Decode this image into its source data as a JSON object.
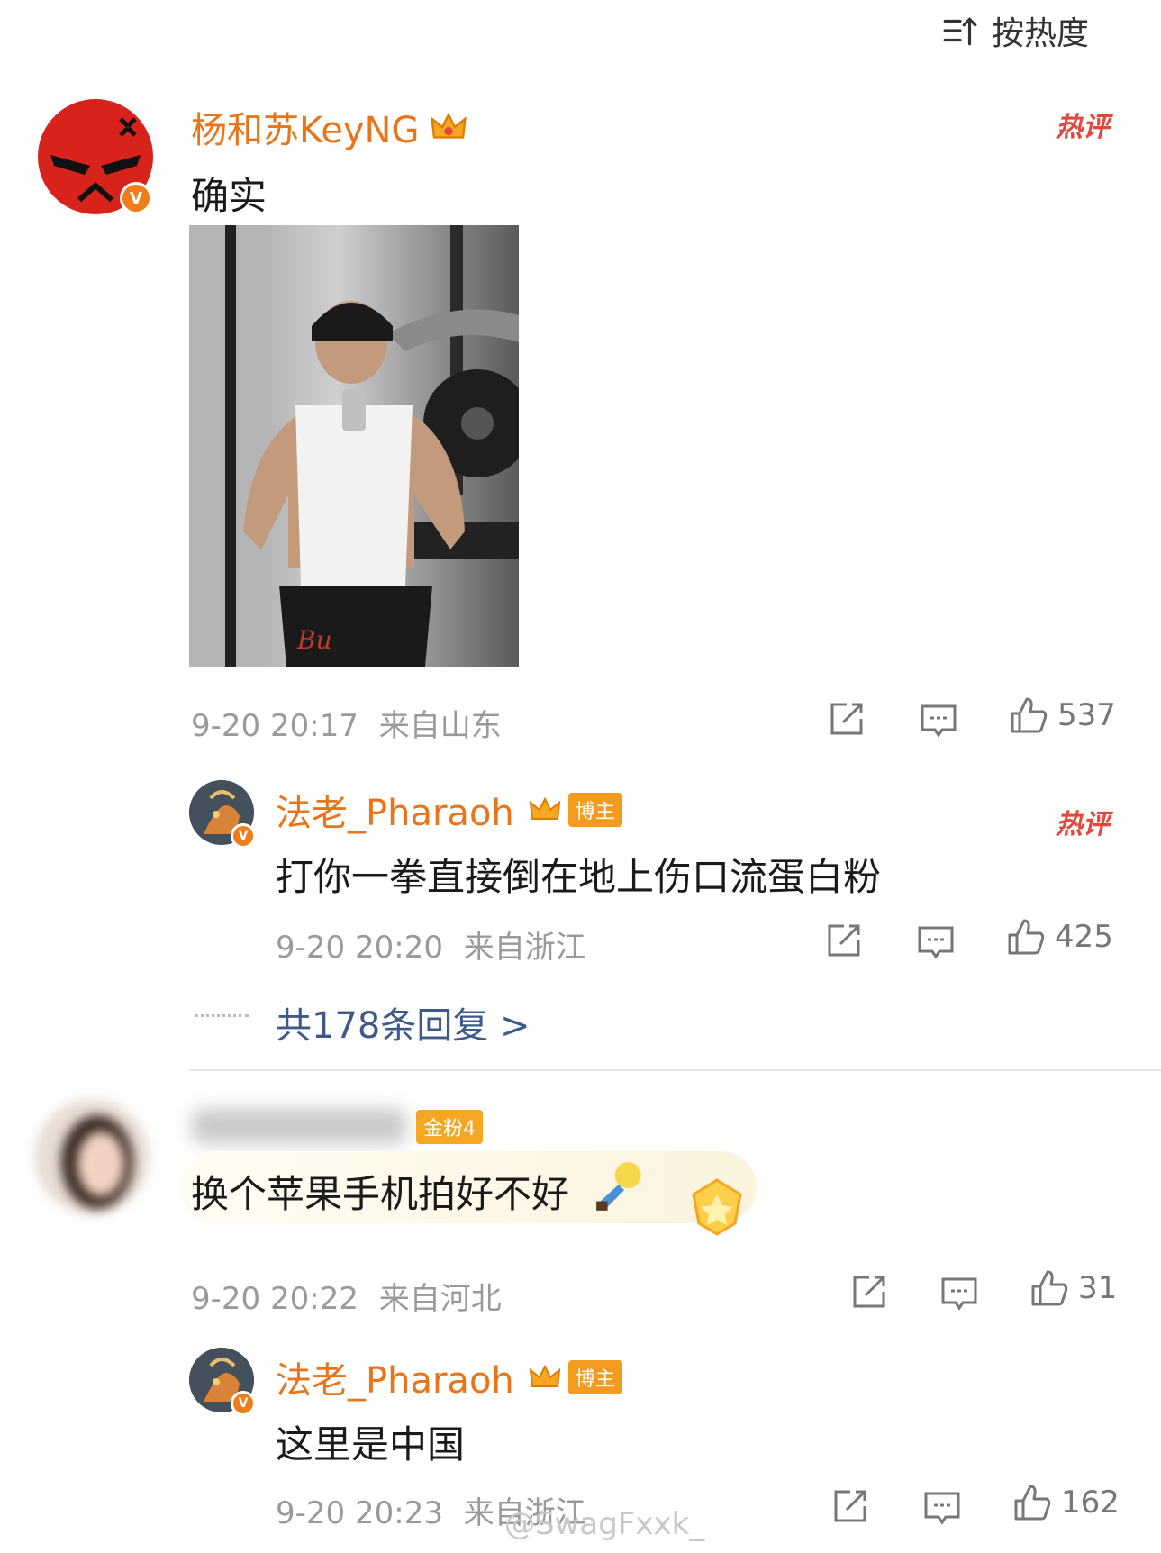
{
  "sort": {
    "label": "按热度"
  },
  "comment1": {
    "username": "杨和苏KeyNG",
    "hot_badge": "热评",
    "text": "确实",
    "time": "9-20 20:17",
    "location": "来自山东",
    "likes": "537",
    "sub_reply": {
      "username": "法老_Pharaoh",
      "role_badge": "博主",
      "hot_badge": "热评",
      "text": "打你一拳直接倒在地上伤口流蛋白粉",
      "time": "9-20 20:20",
      "location": "来自浙江",
      "likes": "425"
    },
    "more_replies": "共178条回复 >"
  },
  "comment2": {
    "fan_badge": "金粉4",
    "text": "换个苹果手机拍好不好",
    "time": "9-20 20:22",
    "location": "来自河北",
    "likes": "31",
    "sub_reply": {
      "username": "法老_Pharaoh",
      "role_badge": "博主",
      "text": "这里是中国",
      "time": "9-20 20:23",
      "location": "来自浙江",
      "likes": "162"
    }
  },
  "watermark": "@SwagFxxk_",
  "colors": {
    "username": "#e8751a",
    "link": "#3e5a8a",
    "hot": "#e3463a",
    "meta": "#9a9a9a",
    "badge": "#f29b1e"
  }
}
